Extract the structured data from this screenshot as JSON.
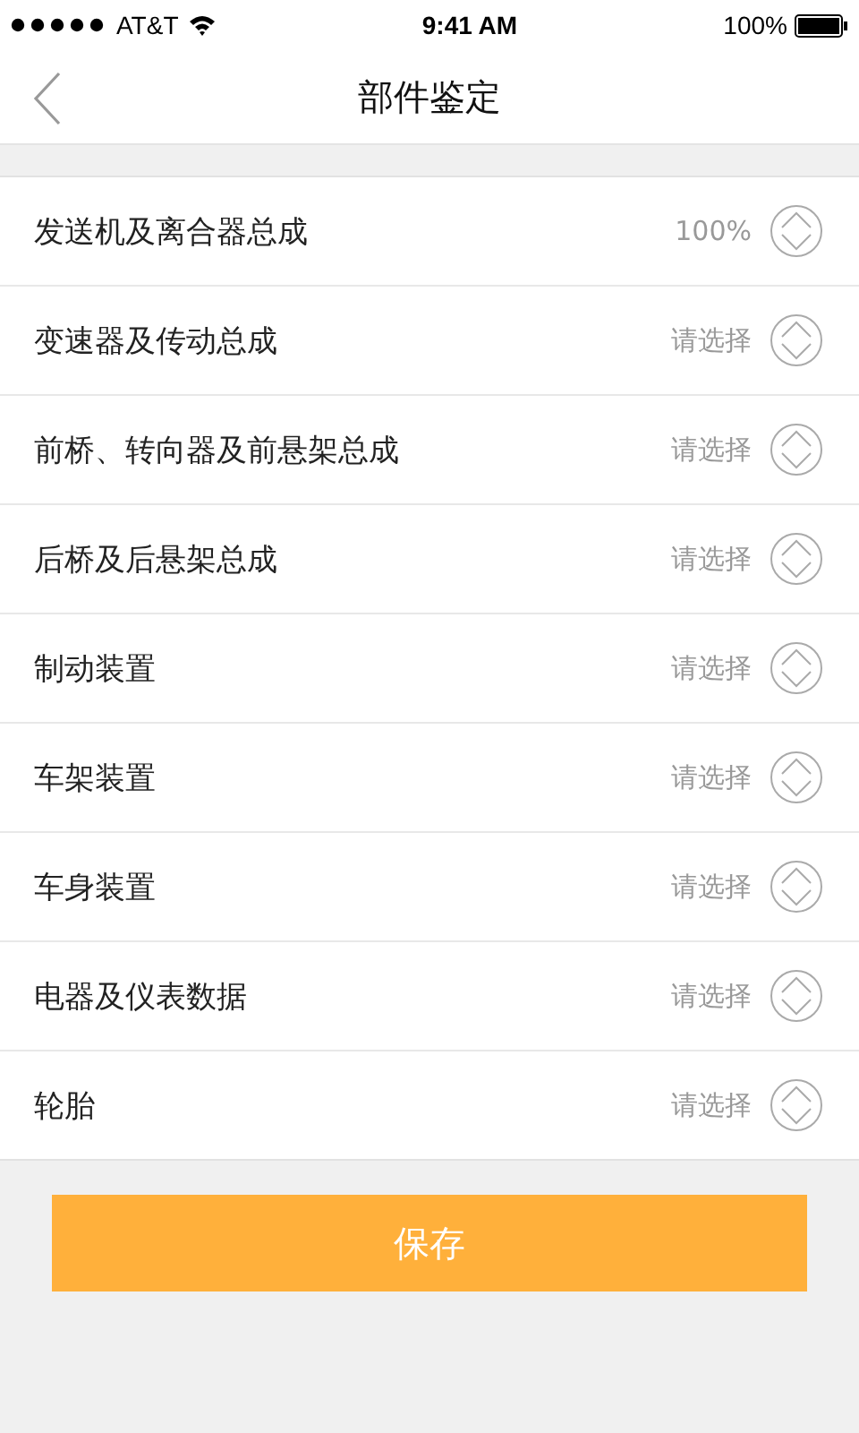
{
  "status_bar": {
    "carrier": "AT&T",
    "time": "9:41 AM",
    "battery": "100%"
  },
  "nav": {
    "title": "部件鉴定"
  },
  "items": [
    {
      "label": "发送机及离合器总成",
      "value": "100%"
    },
    {
      "label": "变速器及传动总成",
      "value": "请选择"
    },
    {
      "label": "前桥、转向器及前悬架总成",
      "value": "请选择"
    },
    {
      "label": "后桥及后悬架总成",
      "value": "请选择"
    },
    {
      "label": "制动装置",
      "value": "请选择"
    },
    {
      "label": "车架装置",
      "value": "请选择"
    },
    {
      "label": "车身装置",
      "value": "请选择"
    },
    {
      "label": "电器及仪表数据",
      "value": "请选择"
    },
    {
      "label": "轮胎",
      "value": "请选择"
    }
  ],
  "save_button": "保存"
}
